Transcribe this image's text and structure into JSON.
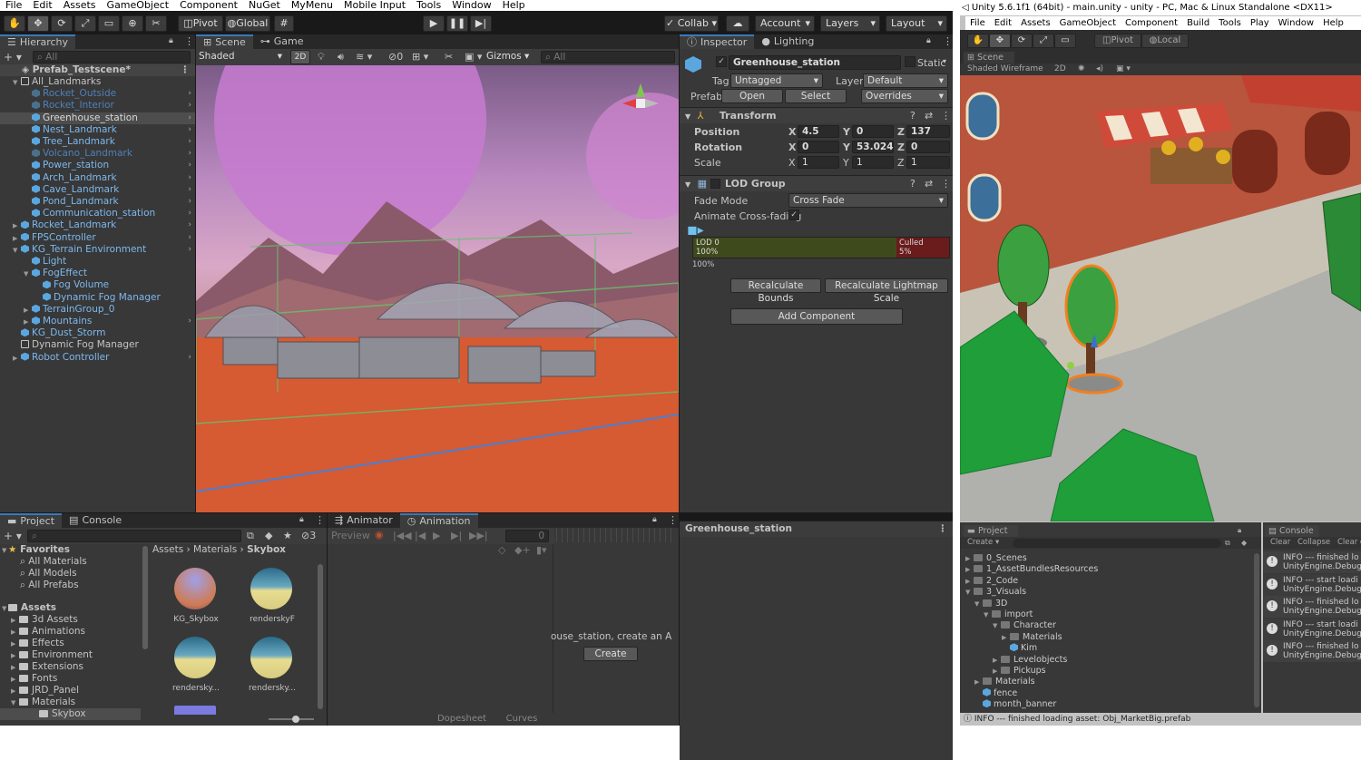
{
  "left": {
    "menubar": [
      "File",
      "Edit",
      "Assets",
      "GameObject",
      "Component",
      "NuGet",
      "MyMenu",
      "Mobile Input",
      "Tools",
      "Window",
      "Help"
    ],
    "toolbar": {
      "pivot": "Pivot",
      "global": "Global",
      "collab": "Collab",
      "account": "Account",
      "layers": "Layers",
      "layout": "Layout"
    },
    "hierarchy": {
      "tab": "Hierarchy",
      "search": "All",
      "scene": "Prefab_Testscene*",
      "items": [
        {
          "label": "All_Landmarks",
          "indent": 1,
          "arrow": "open",
          "icon": "cube-outline",
          "color": "#c4c4c4"
        },
        {
          "label": "Rocket_Outside",
          "indent": 2,
          "icon": "cube-dim",
          "color": "#4f80b8",
          "chev": true
        },
        {
          "label": "Rocket_Interior",
          "indent": 2,
          "icon": "cube-dim",
          "color": "#4f80b8",
          "chev": true
        },
        {
          "label": "Greenhouse_station",
          "indent": 2,
          "icon": "cube",
          "color": "#d8d8d8",
          "chev": true,
          "selected": true
        },
        {
          "label": "Nest_Landmark",
          "indent": 2,
          "icon": "cube",
          "color": "#7cb8ee",
          "chev": true
        },
        {
          "label": "Tree_Landmark",
          "indent": 2,
          "icon": "cube",
          "color": "#7cb8ee",
          "chev": true
        },
        {
          "label": "Volcano_Landmark",
          "indent": 2,
          "icon": "cube-dim",
          "color": "#4f80b8",
          "chev": true
        },
        {
          "label": "Power_station",
          "indent": 2,
          "icon": "cube",
          "color": "#7cb8ee",
          "chev": true
        },
        {
          "label": "Arch_Landmark",
          "indent": 2,
          "icon": "cube",
          "color": "#7cb8ee",
          "chev": true
        },
        {
          "label": "Cave_Landmark",
          "indent": 2,
          "icon": "cube",
          "color": "#7cb8ee",
          "chev": true
        },
        {
          "label": "Pond_Landmark",
          "indent": 2,
          "icon": "cube",
          "color": "#7cb8ee",
          "chev": true
        },
        {
          "label": "Communication_station",
          "indent": 2,
          "icon": "cube",
          "color": "#7cb8ee",
          "chev": true
        },
        {
          "label": "Rocket_Landmark",
          "indent": 1,
          "arrow": "closed",
          "icon": "cube",
          "color": "#7cb8ee",
          "chev": true
        },
        {
          "label": "FPSController",
          "indent": 1,
          "arrow": "closed",
          "icon": "cube",
          "color": "#7cb8ee",
          "chev": true
        },
        {
          "label": "KG_Terrain Environment",
          "indent": 1,
          "arrow": "open",
          "icon": "cube",
          "color": "#7cb8ee",
          "chev": true
        },
        {
          "label": "Light",
          "indent": 2,
          "icon": "cube",
          "color": "#7cb8ee"
        },
        {
          "label": "FogEffect",
          "indent": 2,
          "arrow": "open",
          "icon": "cube",
          "color": "#7cb8ee"
        },
        {
          "label": "Fog Volume",
          "indent": 3,
          "icon": "cube",
          "color": "#7cb8ee"
        },
        {
          "label": "Dynamic Fog Manager",
          "indent": 3,
          "icon": "cube",
          "color": "#7cb8ee"
        },
        {
          "label": "TerrainGroup_0",
          "indent": 2,
          "arrow": "closed",
          "icon": "cube",
          "color": "#7cb8ee"
        },
        {
          "label": "Mountains",
          "indent": 2,
          "arrow": "closed",
          "icon": "cube",
          "color": "#7cb8ee",
          "chev": true
        },
        {
          "label": "KG_Dust_Storm",
          "indent": 1,
          "icon": "cube",
          "color": "#7cb8ee"
        },
        {
          "label": "Dynamic Fog Manager",
          "indent": 1,
          "icon": "cube-outline",
          "color": "#c4c4c4"
        },
        {
          "label": "Robot Controller",
          "indent": 1,
          "arrow": "closed",
          "icon": "cube",
          "color": "#7cb8ee",
          "chev": true
        }
      ]
    },
    "scene": {
      "tab_scene": "Scene",
      "tab_game": "Game",
      "shading": "Shaded",
      "mode2d": "2D",
      "gizmos": "Gizmos",
      "search": "All",
      "hidden_count": "0"
    },
    "inspector": {
      "tab": "Inspector",
      "tab2": "Lighting",
      "object_name": "Greenhouse_station",
      "static": "Static",
      "tag_label": "Tag",
      "tag_value": "Untagged",
      "layer_label": "Layer",
      "layer_value": "Default",
      "prefab_label": "Prefab",
      "open": "Open",
      "select": "Select",
      "overrides": "Overrides",
      "transform": {
        "title": "Transform",
        "position": "Position",
        "rotation": "Rotation",
        "scale": "Scale",
        "pos": [
          "4.5",
          "0",
          "137"
        ],
        "rot": [
          "0",
          "53.024",
          "0"
        ],
        "scl": [
          "1",
          "1",
          "1"
        ],
        "axes": [
          "X",
          "Y",
          "Z"
        ]
      },
      "lod": {
        "title": "LOD Group",
        "fade_mode_label": "Fade Mode",
        "fade_mode": "Cross Fade",
        "animate_label": "Animate Cross-fading",
        "lod0": "LOD 0",
        "lod0_pct": "100%",
        "culled": "Culled",
        "culled_pct": "5%",
        "scale_pct": "100%",
        "recalc_bounds": "Recalculate Bounds",
        "recalc_lightmap": "Recalculate Lightmap Scale"
      },
      "add_component": "Add Component",
      "preview_title": "Greenhouse_station"
    },
    "project": {
      "tab": "Project",
      "tab2": "Console",
      "hidden_count": "3",
      "favorites": "Favorites",
      "fav_items": [
        "All Materials",
        "All Models",
        "All Prefabs"
      ],
      "assets": "Assets",
      "folders": [
        "3d Assets",
        "Animations",
        "Effects",
        "Environment",
        "Extensions",
        "Fonts",
        "JRD_Panel",
        "Materials",
        "Skybox"
      ],
      "breadcrumb": [
        "Assets",
        "Materials",
        "Skybox"
      ],
      "thumbs": [
        "KG_Skybox",
        "renderskyF",
        "rendersky...",
        "rendersky..."
      ]
    },
    "animation": {
      "tab": "Animator",
      "tab2": "Animation",
      "preview": "Preview",
      "frame": "0",
      "msg": "ouse_station, create an Anim",
      "create": "Create",
      "dopesheet": "Dopesheet",
      "curves": "Curves"
    }
  },
  "right": {
    "title": "Unity 5.6.1f1 (64bit) - main.unity - unity - PC, Mac & Linux Standalone <DX11>",
    "menubar": [
      "File",
      "Edit",
      "Assets",
      "GameObject",
      "Component",
      "Build",
      "Tools",
      "Play",
      "Window",
      "Help"
    ],
    "pivot": "Pivot",
    "local": "Local",
    "scene_tab": "Scene",
    "shading": "Shaded Wireframe",
    "mode2d": "2D",
    "project": {
      "tab": "Project",
      "create": "Create",
      "tree": [
        {
          "label": "0_Scenes",
          "indent": 0
        },
        {
          "label": "1_AssetBundlesResources",
          "indent": 0
        },
        {
          "label": "2_Code",
          "indent": 0
        },
        {
          "label": "3_Visuals",
          "indent": 0,
          "open": true
        },
        {
          "label": "3D",
          "indent": 1,
          "open": true
        },
        {
          "label": "import",
          "indent": 2,
          "open": true
        },
        {
          "label": "Character",
          "indent": 3,
          "open": true
        },
        {
          "label": "Materials",
          "indent": 4
        },
        {
          "label": "Kim",
          "indent": 4,
          "cube": true
        },
        {
          "label": "Levelobjects",
          "indent": 3
        },
        {
          "label": "Pickups",
          "indent": 3
        },
        {
          "label": "Materials",
          "indent": 1
        },
        {
          "label": "fence",
          "indent": 1,
          "cube": true
        },
        {
          "label": "month_banner",
          "indent": 1,
          "cube": true
        }
      ]
    },
    "console": {
      "tab": "Console",
      "clear": "Clear",
      "collapse": "Collapse",
      "clear_on_play": "Clear o",
      "entries": [
        [
          "INFO --- finished lo",
          "UnityEngine.Debug"
        ],
        [
          "INFO --- start loadi",
          "UnityEngine.Debug"
        ],
        [
          "INFO --- finished lo",
          "UnityEngine.Debug"
        ],
        [
          "INFO --- start loadi",
          "UnityEngine.Debug"
        ],
        [
          "INFO --- finished lo",
          "UnityEngine.Debug"
        ]
      ]
    },
    "status": "INFO --- finished loading asset: Obj_MarketBig.prefab"
  }
}
